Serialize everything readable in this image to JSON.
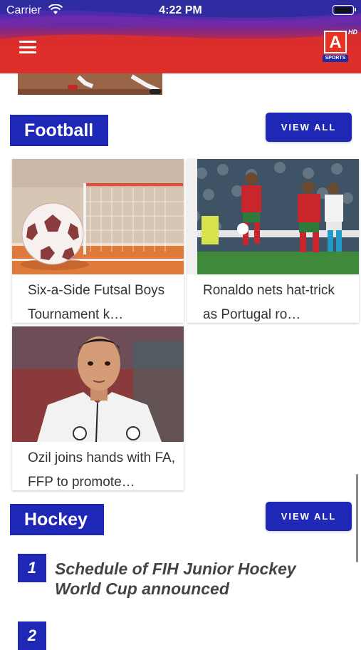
{
  "status_bar": {
    "carrier": "Carrier",
    "time": "4:22 PM"
  },
  "header": {
    "logo_letter": "A",
    "logo_badge": "HD",
    "logo_sub": "SPORTS",
    "brand_color": "#1f27b7",
    "accent_color": "#e43a30"
  },
  "football": {
    "title": "Football",
    "view_all": "VIEW ALL",
    "cards": [
      {
        "title": "Six-a-Side Futsal Boys Tournament k…"
      },
      {
        "title": "Ronaldo nets hat-trick as Portugal ro…"
      },
      {
        "title": "Ozil joins hands with FA, FFP to promote…"
      }
    ]
  },
  "hockey": {
    "title": "Hockey",
    "view_all": "VIEW ALL",
    "items": [
      {
        "rank": "1",
        "title": "Schedule of FIH Junior Hockey World Cup announced"
      },
      {
        "rank": "2"
      }
    ]
  }
}
